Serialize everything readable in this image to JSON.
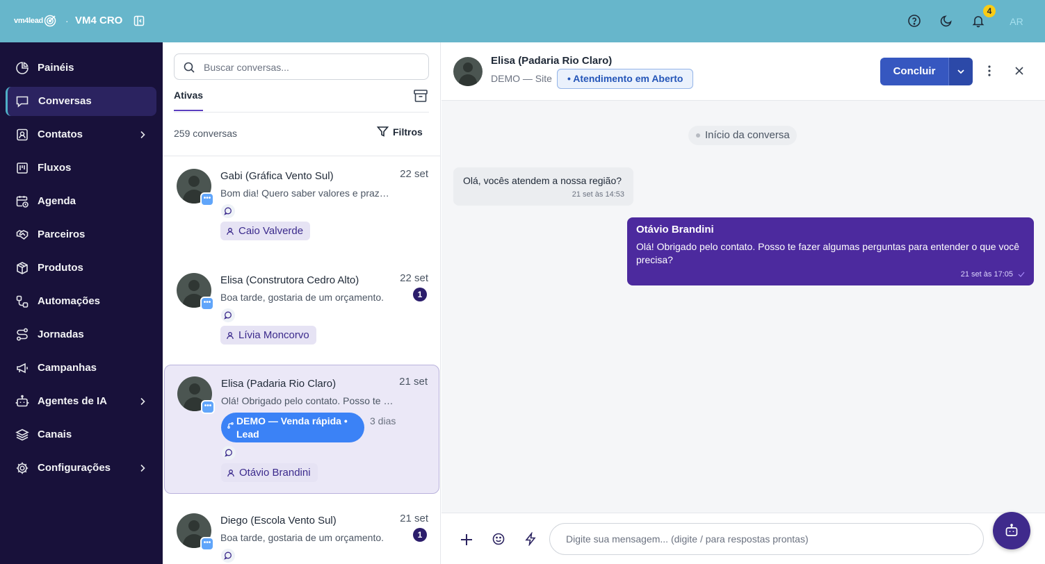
{
  "topbar": {
    "logo_text": "vm4lead",
    "brand_separator": "·",
    "brand": "VM4 CRO",
    "notification_count": "4",
    "user_initials": "AR"
  },
  "sidebar": {
    "items": [
      {
        "label": "Painéis",
        "icon": "dashboard-icon",
        "active": false
      },
      {
        "label": "Conversas",
        "icon": "chat-icon",
        "active": true
      },
      {
        "label": "Contatos",
        "icon": "contacts-icon",
        "has_chevron": true
      },
      {
        "label": "Fluxos",
        "icon": "kanban-icon"
      },
      {
        "label": "Agenda",
        "icon": "calendar-clock-icon"
      },
      {
        "label": "Parceiros",
        "icon": "handshake-icon"
      },
      {
        "label": "Produtos",
        "icon": "package-icon"
      },
      {
        "label": "Automações",
        "icon": "workflow-icon"
      },
      {
        "label": "Jornadas",
        "icon": "route-icon"
      },
      {
        "label": "Campanhas",
        "icon": "megaphone-icon"
      },
      {
        "label": "Agentes de IA",
        "icon": "bot-icon",
        "has_chevron": true
      },
      {
        "label": "Canais",
        "icon": "layers-icon"
      },
      {
        "label": "Configurações",
        "icon": "gear-icon",
        "has_chevron": true
      }
    ]
  },
  "conversations": {
    "search_placeholder": "Buscar conversas...",
    "active_tab": "Ativas",
    "count_label": "259 conversas",
    "filters_label": "Filtros",
    "items": [
      {
        "name": "Gabi (Gráfica Vento Sul)",
        "date": "22 set",
        "preview": "Bom dia! Quero saber valores e prazos para um pedido.",
        "agent": "Caio Valverde"
      },
      {
        "name": "Elisa (Construtora Cedro Alto)",
        "date": "22 set",
        "preview": "Boa tarde, gostaria de um orçamento.",
        "unread": "1",
        "agent": "Lívia Moncorvo"
      },
      {
        "name": "Elisa (Padaria Rio Claro)",
        "date": "21 set",
        "preview": "Olá! Obrigado pelo contato. Posso te fazer algumas perguntas",
        "flow": "DEMO — Venda rápida • Lead",
        "flow_age": "3 dias",
        "agent": "Otávio Brandini"
      },
      {
        "name": "Diego (Escola Vento Sul)",
        "date": "21 set",
        "preview": "Boa tarde, gostaria de um orçamento.",
        "unread": "1"
      }
    ]
  },
  "chat": {
    "contact_name": "Elisa (Padaria Rio Claro)",
    "source": "DEMO — Site",
    "status": "• Atendimento em Aberto",
    "conclude_label": "Concluir",
    "conversation_start": "Início da conversa",
    "messages": [
      {
        "direction": "in",
        "text": "Olá, vocês atendem a nossa região?",
        "time": "21 set às 14:53"
      },
      {
        "direction": "out",
        "author": "Otávio Brandini",
        "text": "Olá! Obrigado pelo contato. Posso te fazer algumas perguntas para entender o que você precisa?",
        "time": "21 set às 17:05"
      }
    ],
    "composer_placeholder": "Digite sua mensagem... (digite / para respostas prontas)"
  },
  "colors": {
    "topbar": "#67b6cb",
    "sidebar": "#18113a",
    "accent_purple": "#4c2a9e",
    "conclude_blue": "#3657c0"
  }
}
